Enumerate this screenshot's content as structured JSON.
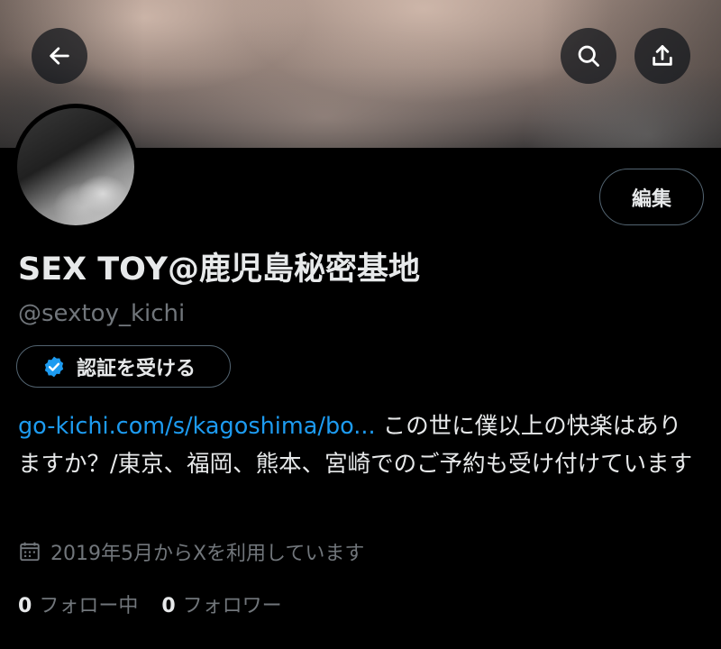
{
  "header": {
    "back_icon": "arrow-left-icon",
    "search_icon": "search-icon",
    "share_icon": "share-icon"
  },
  "profile": {
    "edit_label": "編集",
    "display_name": "SEX TOY@鹿児島秘密基地",
    "handle": "@sextoy_kichi",
    "verify_label": "認証を受ける",
    "bio_link": "go-kichi.com/s/kagoshima/bo...",
    "bio_text": " この世に僕以上の快楽はありますか？/東京、福岡、熊本、宮崎でのご予約も受け付けています",
    "joined": "2019年5月からXを利用しています",
    "following_count": "0",
    "following_label": "フォロー中",
    "followers_count": "0",
    "followers_label": "フォロワー"
  },
  "colors": {
    "accent": "#1d9bf0",
    "muted": "#71767b",
    "border": "#536471",
    "background": "#000000"
  }
}
